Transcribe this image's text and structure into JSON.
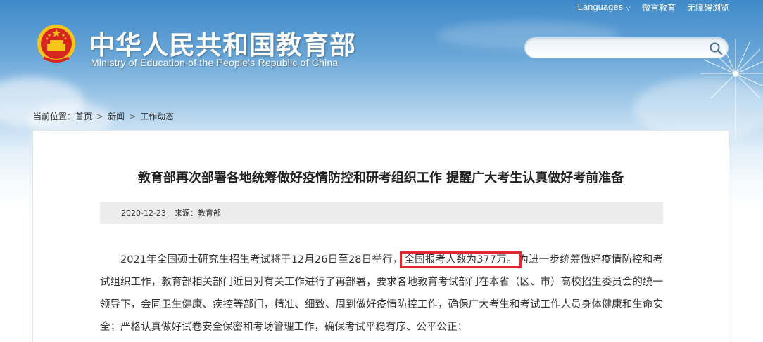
{
  "top_links": {
    "languages": "Languages",
    "weibo": "微言教育",
    "accessible": "无障碍浏览"
  },
  "header": {
    "title": "中华人民共和国教育部",
    "subtitle": "Ministry of Education of the People's Republic of China"
  },
  "search": {
    "value": "",
    "placeholder": ""
  },
  "breadcrumb": {
    "prefix": "当前位置：",
    "items": [
      "首页",
      "新闻",
      "工作动态"
    ]
  },
  "article": {
    "title": "教育部再次部署各地统筹做好疫情防控和研考组织工作 提醒广大考生认真做好考前准备",
    "date": "2020-12-23",
    "source": "来源：教育部",
    "body_before": "2021年全国硕士研究生招生考试将于12月26日至28日举行，",
    "body_highlight": "全国报考人数为377万。",
    "body_after": "为进一步统筹做好疫情防控和考试组织工作，教育部相关部门近日对有关工作进行了再部署，要求各地教育考试部门在本省（区、市）高校招生委员会的统一领导下，会同卫生健康、疾控等部门，精准、细致、周到做好疫情防控工作，确保广大考生和考试工作人员身体健康和生命安全；严格认真做好试卷安全保密和考场管理工作，确保考试平稳有序、公平公正；"
  },
  "colors": {
    "highlight_border": "#e0262e",
    "sky_top": "#3f89c9",
    "emblem_red": "#d7261e",
    "emblem_gold": "#f5c518"
  }
}
